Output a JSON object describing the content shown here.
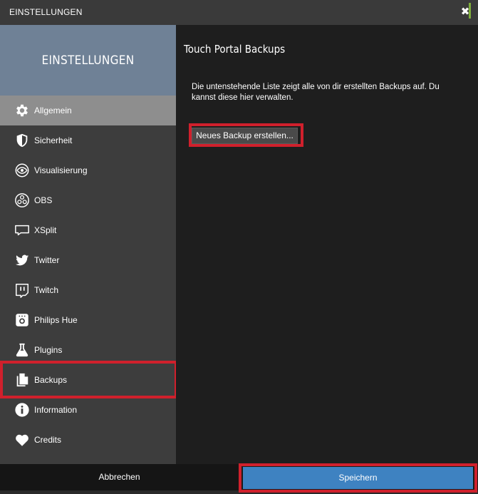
{
  "window": {
    "title": "EINSTELLUNGEN",
    "close_glyph": "✖",
    "accent_color": "#7fae3c"
  },
  "sidebar": {
    "header": "EINSTELLUNGEN",
    "header_color": "#6f8196",
    "active_item": "Allgemein",
    "items": [
      {
        "label": "Allgemein",
        "icon": "gear-icon"
      },
      {
        "label": "Sicherheit",
        "icon": "shield-icon"
      },
      {
        "label": "Visualisierung",
        "icon": "eye-icon"
      },
      {
        "label": "OBS",
        "icon": "obs-icon"
      },
      {
        "label": "XSplit",
        "icon": "xsplit-icon"
      },
      {
        "label": "Twitter",
        "icon": "twitter-icon"
      },
      {
        "label": "Twitch",
        "icon": "twitch-icon"
      },
      {
        "label": "Philips Hue",
        "icon": "hue-bridge-icon"
      },
      {
        "label": "Plugins",
        "icon": "flask-icon"
      },
      {
        "label": "Backups",
        "icon": "documents-icon"
      },
      {
        "label": "Information",
        "icon": "info-icon"
      },
      {
        "label": "Credits",
        "icon": "heart-icon"
      }
    ]
  },
  "main": {
    "heading": "Touch Portal Backups",
    "description": "Die untenstehende Liste zeigt alle von dir erstellten Backups auf. Du kannst diese hier verwalten.",
    "new_backup_label": "Neues Backup erstellen..."
  },
  "footer": {
    "cancel_label": "Abbrechen",
    "save_label": "Speichern",
    "save_color": "#3e82c1"
  },
  "highlight_color": "#d0202c"
}
